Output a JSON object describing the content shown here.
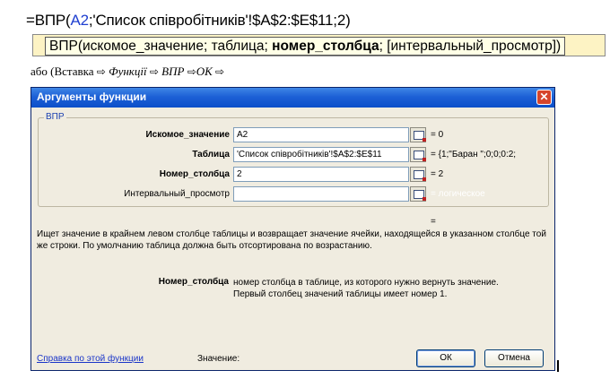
{
  "formula": {
    "prefix": "=ВПР(",
    "cell_ref": "A2",
    "rest": ";'Список співробітників'!$A$2:$E$11;2)"
  },
  "tooltip": {
    "before": "ВПР(искомое_значение; таблица; ",
    "bold": "номер_столбца",
    "after": "; [интервальный_просмотр])"
  },
  "caption": {
    "lead": "або (Вставка ",
    "step1": "Функції",
    "step2": "ВПР",
    "step3": "ОК",
    "arrow": "⇨"
  },
  "dialog": {
    "title": "Аргументы функции",
    "close_glyph": "✕",
    "group_label": "ВПР",
    "args": [
      {
        "label": "Искомое_значение",
        "value": "A2",
        "result": "= 0"
      },
      {
        "label": "Таблица",
        "value": "'Список співробітників'!$A$2:$E$11",
        "result": "= {1;\"Баран \";0;0;0:2;"
      },
      {
        "label": "Номер_столбца",
        "value": "2",
        "result": "= 2"
      },
      {
        "label": "Интервальный_просмотр",
        "value": "",
        "result": "= логическое"
      }
    ],
    "equals": "=",
    "description": "Ищет значение в крайнем левом столбце таблицы и возвращает значение ячейки, находящейся в указанном столбце той же строки. По умолчанию таблица должна быть отсортирована по возрастанию.",
    "param_name": "Номер_столбца",
    "param_desc_1": "номер столбца в таблице, из которого нужно вернуть значение.",
    "param_desc_2": "Первый столбец значений таблицы имеет номер 1.",
    "help_link": "Справка по этой функции",
    "value_label": "Значение:",
    "ok_label": "ОК",
    "cancel_label": "Отмена"
  }
}
